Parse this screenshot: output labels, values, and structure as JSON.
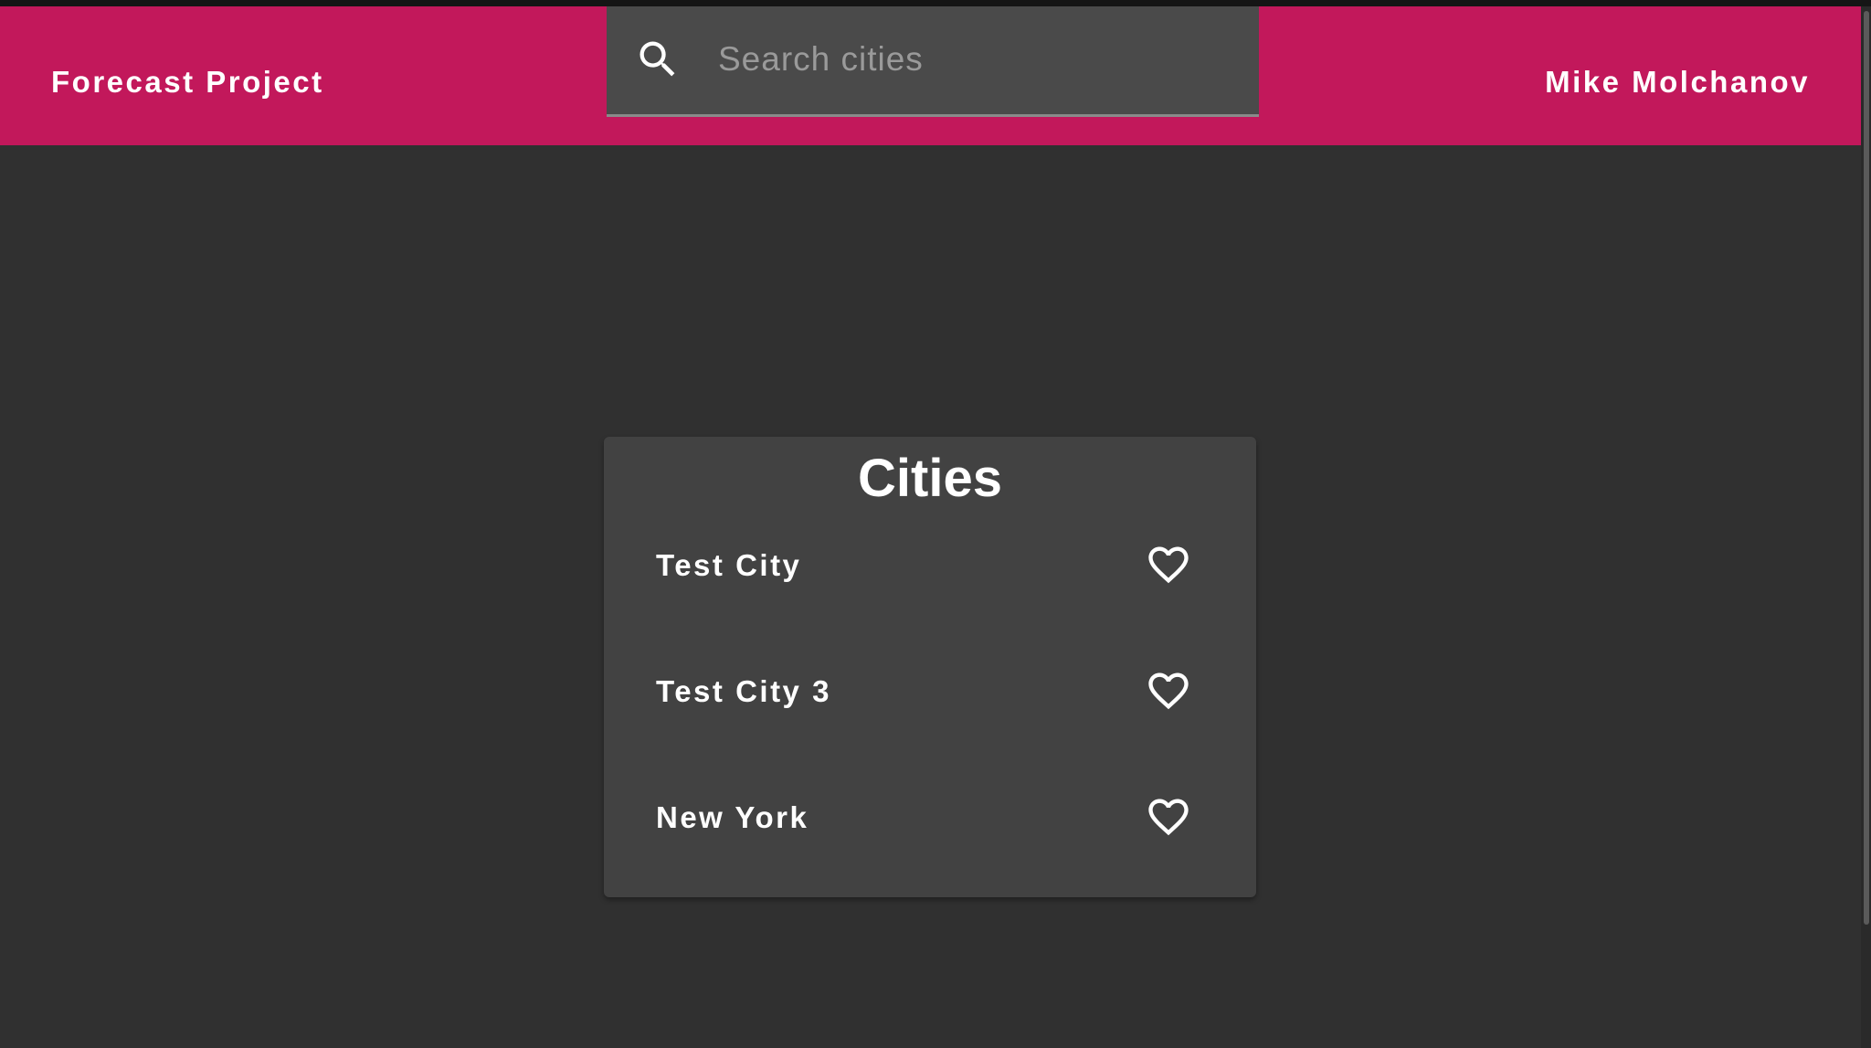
{
  "app_bar": {
    "title": "Forecast Project",
    "user_name": "Mike Molchanov",
    "color": "#c2185b"
  },
  "search": {
    "placeholder": "Search cities",
    "value": "",
    "icon": "search-icon"
  },
  "cities_panel": {
    "title": "Cities",
    "items": [
      {
        "label": "Test City",
        "favorite_icon": "heart-outline-icon",
        "favorite": false
      },
      {
        "label": "Test City 3",
        "favorite_icon": "heart-outline-icon",
        "favorite": false
      },
      {
        "label": "New York",
        "favorite_icon": "heart-outline-icon",
        "favorite": false
      }
    ]
  },
  "colors": {
    "background": "#303030",
    "card": "#424242",
    "search_field": "#4a4a4a",
    "text": "#ffffff"
  }
}
